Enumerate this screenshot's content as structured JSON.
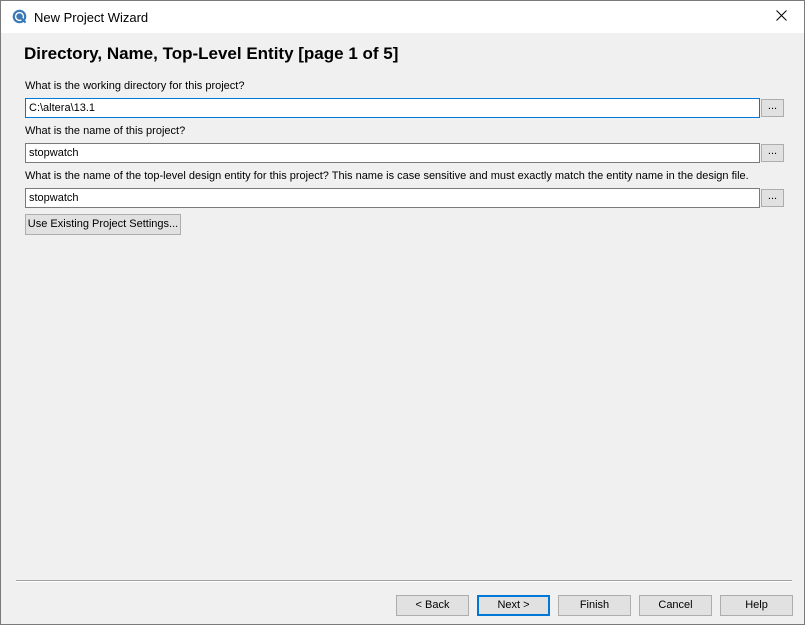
{
  "window": {
    "title": "New Project Wizard",
    "close_glyph": "✕",
    "icon": "quartus-app-icon"
  },
  "page": {
    "heading": "Directory, Name, Top-Level Entity [page 1 of 5]"
  },
  "fields": {
    "directory": {
      "label": "What is the working directory for this project?",
      "value": "C:\\altera\\13.1",
      "browse_label": "..."
    },
    "project_name": {
      "label": "What is the name of this project?",
      "value": "stopwatch",
      "browse_label": "..."
    },
    "top_entity": {
      "label": "What is the name of the top-level design entity for this project? This name is case sensitive and must exactly match the entity name in the design file.",
      "value": "stopwatch",
      "browse_label": "..."
    }
  },
  "use_existing_label": "Use Existing Project Settings...",
  "footer": {
    "back_label": "< Back",
    "next_label": "Next >",
    "finish_label": "Finish",
    "cancel_label": "Cancel",
    "help_label": "Help"
  },
  "colors": {
    "focus_accent": "#0078d7",
    "dialog_bg": "#f0f0f0"
  }
}
